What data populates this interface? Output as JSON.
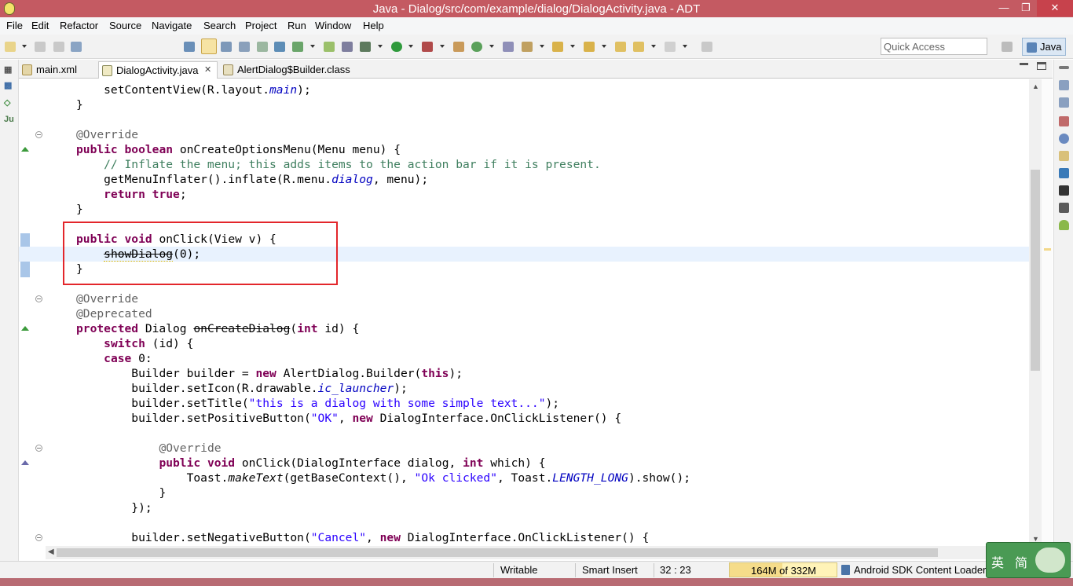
{
  "window": {
    "title": "Java - Dialog/src/com/example/dialog/DialogActivity.java - ADT",
    "minimize": "—",
    "restore": "❐",
    "close": "✕"
  },
  "menubar": [
    "File",
    "Edit",
    "Refactor",
    "Source",
    "Navigate",
    "Search",
    "Project",
    "Run",
    "Window",
    "Help"
  ],
  "toolbar": {
    "quick_access_placeholder": "Quick Access",
    "perspective_label": "Java"
  },
  "tabs": [
    {
      "label": "main.xml",
      "active": false
    },
    {
      "label": "DialogActivity.java",
      "active": true,
      "close": "✕"
    },
    {
      "label": "AlertDialog$Builder.class",
      "active": false
    }
  ],
  "code": {
    "l0": "    setContentView(R.layout.",
    "l0_it": "main",
    "l0_end": ");",
    "l1": "}",
    "l3": "@Override",
    "l4_kw1": "public",
    "l4_kw2": "boolean",
    "l4_rest": " onCreateOptionsMenu(Menu menu) {",
    "l5": "    // Inflate the menu; this adds items to the action bar if it is present.",
    "l6_a": "    getMenuInflater().inflate(R.menu.",
    "l6_it": "dialog",
    "l6_b": ", menu);",
    "l7_kw1": "return",
    "l7_kw2": "true",
    "l7_end": ";",
    "l8": "}",
    "l10_kw1": "public",
    "l10_kw2": "void",
    "l10_rest": " onClick(View v) {",
    "l11_strike": "showDialog",
    "l11_rest": "(0);",
    "l12": "}",
    "l14": "@Override",
    "l15": "@Deprecated",
    "l16_kw": "protected",
    "l16_a": " Dialog ",
    "l16_strike": "onCreateDialog",
    "l16_b": "(",
    "l16_kw2": "int",
    "l16_c": " id) {",
    "l17_kw": "switch",
    "l17_rest": " (id) {",
    "l18_kw": "case",
    "l18_rest": " 0:",
    "l19_a": "Builder builder = ",
    "l19_kw": "new",
    "l19_b": " AlertDialog.Builder(",
    "l19_kw2": "this",
    "l19_c": ");",
    "l20_a": "builder.setIcon(R.drawable.",
    "l20_it": "ic_launcher",
    "l20_b": ");",
    "l21_a": "builder.setTitle(",
    "l21_str": "\"this is a dialog with some simple text...\"",
    "l21_b": ");",
    "l22_a": "builder.setPositiveButton(",
    "l22_str": "\"OK\"",
    "l22_b": ", ",
    "l22_kw": "new",
    "l22_c": " DialogInterface.OnClickListener() {",
    "l24": "@Override",
    "l25_kw1": "public",
    "l25_kw2": "void",
    "l25_a": " onClick(DialogInterface dialog, ",
    "l25_kw3": "int",
    "l25_b": " which) {",
    "l26_a": "Toast.",
    "l26_it": "makeText",
    "l26_b": "(getBaseContext(), ",
    "l26_str": "\"Ok clicked\"",
    "l26_c": ", Toast.",
    "l26_it2": "LENGTH_LONG",
    "l26_d": ").show();",
    "l27": "}",
    "l28": "});",
    "l30_a": "builder.setNegativeButton(",
    "l30_str": "\"Cancel\"",
    "l30_b": ", ",
    "l30_kw": "new",
    "l30_c": " DialogInterface.OnClickListener() {"
  },
  "status": {
    "writable": "Writable",
    "insert_mode": "Smart Insert",
    "position": "32 : 23",
    "heap": "164M of 332M",
    "heap_fraction": 0.494,
    "job": "Android SDK Content Loader"
  },
  "ime": {
    "lang": "英",
    "mode": "简"
  },
  "colors": {
    "titlebar": "#c45a62",
    "keyword": "#7f0055",
    "string": "#2a00ff",
    "comment": "#3f7f5f",
    "highlight_box": "#e3262b"
  }
}
